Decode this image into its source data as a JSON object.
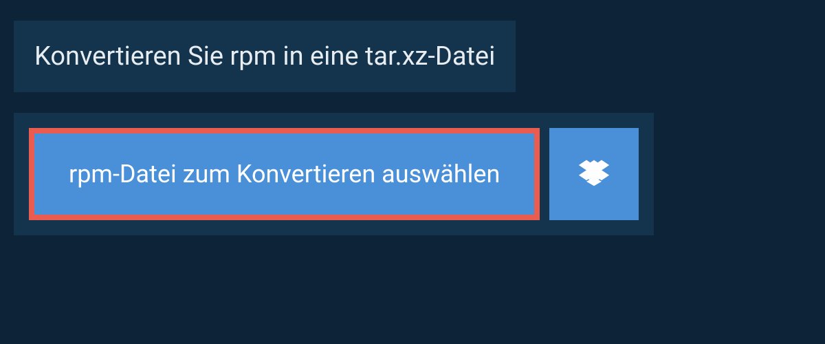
{
  "header": {
    "title": "Konvertieren Sie rpm in eine tar.xz-Datei"
  },
  "actions": {
    "select_file_label": "rpm-Datei zum Konvertieren auswählen",
    "dropbox_icon_name": "dropbox"
  },
  "colors": {
    "page_bg": "#0d2438",
    "panel_bg": "#14334d",
    "button_bg": "#4a90d9",
    "highlight_border": "#e95c4f",
    "text_light": "#e8edf2",
    "text_white": "#ffffff"
  }
}
